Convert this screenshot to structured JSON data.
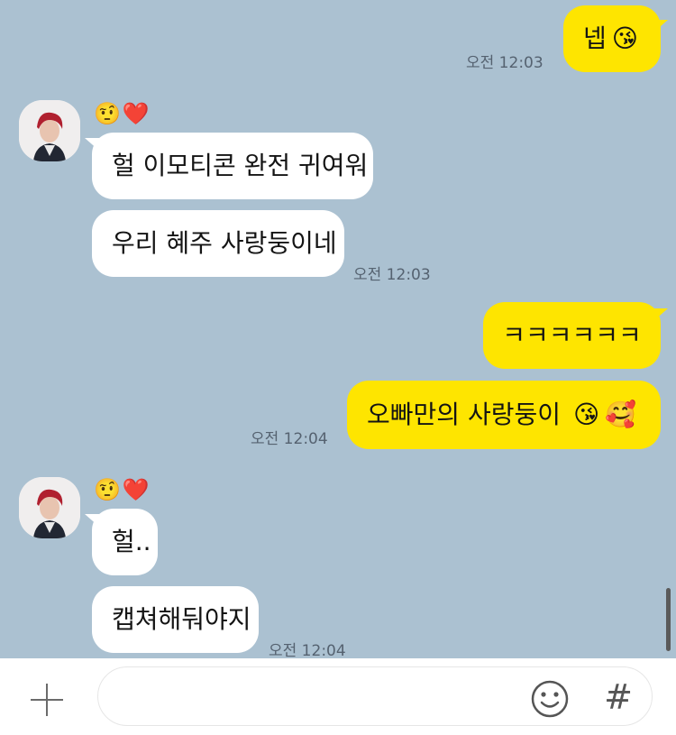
{
  "messages": {
    "m1_text": "넵",
    "m1_time": "오전 12:03",
    "m2_text": "헐 이모티콘 완전 귀여워",
    "m3_text": "우리 혜주 사랑둥이네",
    "m3_time": "오전 12:03",
    "m4_text": "ㅋㅋㅋㅋㅋㅋ",
    "m5_text": "오빠만의 사랑둥이",
    "m5_time": "오전 12:04",
    "m6_text": "헐..",
    "m7_text": "캡쳐해둬야지",
    "m7_time": "오전 12:04"
  },
  "emoji": {
    "kiss": "😘",
    "smiling_hearts": "🥰",
    "raised_eyebrow": "🤨",
    "heart": "❤️"
  },
  "colors": {
    "background": "#abc1d1",
    "outgoing_bubble": "#fee500",
    "incoming_bubble": "#ffffff"
  },
  "input": {
    "placeholder": ""
  },
  "icons": {
    "hash": "#",
    "plus": "plus-icon",
    "emoticon": "smiley-icon"
  }
}
